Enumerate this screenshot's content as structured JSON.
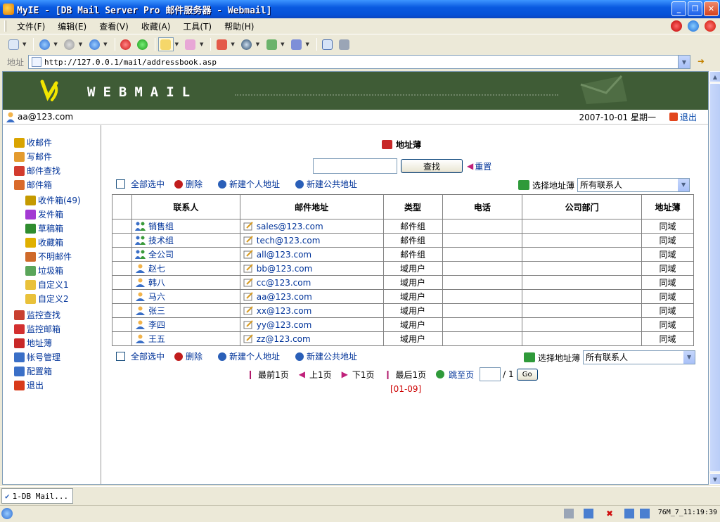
{
  "window": {
    "title": "MyIE - [DB Mail Server Pro 邮件服务器 - Webmail]"
  },
  "menu": [
    "文件(F)",
    "编辑(E)",
    "查看(V)",
    "收藏(A)",
    "工具(T)",
    "帮助(H)"
  ],
  "address": {
    "label": "地址",
    "url": "http://127.0.0.1/mail/addressbook.asp"
  },
  "banner": {
    "brand": "WEBMAIL"
  },
  "user": {
    "email": "aa@123.com",
    "date": "2007-10-01 星期一",
    "logout": "退出"
  },
  "sidebar": [
    {
      "label": "收邮件",
      "icon": "inbox-icon",
      "color": "#d9a400",
      "level": 0
    },
    {
      "label": "写邮件",
      "icon": "pencil-icon",
      "color": "#e49b2e",
      "level": 0
    },
    {
      "label": "邮件查找",
      "icon": "people-icon",
      "color": "#d23b2e",
      "level": 0
    },
    {
      "label": "邮件箱",
      "icon": "house-icon",
      "color": "#d96a2a",
      "level": 0
    },
    {
      "label": "收件箱(49)",
      "icon": "inbox-icon",
      "color": "#c59a00",
      "level": 1
    },
    {
      "label": "发件箱",
      "icon": "outbox-icon",
      "color": "#a33ad3",
      "level": 1
    },
    {
      "label": "草稿箱",
      "icon": "draft-icon",
      "color": "#2f8c2f",
      "level": 1
    },
    {
      "label": "收藏箱",
      "icon": "star-icon",
      "color": "#e0b000",
      "level": 1
    },
    {
      "label": "不明邮件",
      "icon": "unknown-mail-icon",
      "color": "#cf6a2a",
      "level": 1
    },
    {
      "label": "垃圾箱",
      "icon": "trash-icon",
      "color": "#5aa55a",
      "level": 1
    },
    {
      "label": "自定义1",
      "icon": "folder-icon",
      "color": "#e9c13a",
      "level": 1
    },
    {
      "label": "自定义2",
      "icon": "folder-icon",
      "color": "#e9c13a",
      "level": 1
    },
    {
      "label": "监控查找",
      "icon": "monitor-search-icon",
      "color": "#c84030",
      "level": 0
    },
    {
      "label": "监控邮箱",
      "icon": "monitor-mailbox-icon",
      "color": "#d33030",
      "level": 0
    },
    {
      "label": "地址薄",
      "icon": "addressbook-icon",
      "color": "#c82828",
      "level": 0
    },
    {
      "label": "帐号管理",
      "icon": "accounts-icon",
      "color": "#3a6fc7",
      "level": 0
    },
    {
      "label": "配置箱",
      "icon": "config-icon",
      "color": "#3a6fc7",
      "level": 0
    },
    {
      "label": "退出",
      "icon": "logout-icon",
      "color": "#d83a1a",
      "level": 0
    }
  ],
  "main": {
    "title": "地址薄",
    "search_button": "查找",
    "reset": "重置",
    "select_all": "全部选中",
    "delete": "删除",
    "new_personal": "新建个人地址",
    "new_public": "新建公共地址",
    "choose_book": "选择地址薄",
    "book_value": "所有联系人",
    "columns": [
      "联系人",
      "邮件地址",
      "类型",
      "电话",
      "公司部门",
      "地址薄"
    ],
    "rows": [
      {
        "name": "销售组",
        "email": "sales@123.com",
        "type": "邮件组",
        "phone": "",
        "dept": "",
        "book": "同域",
        "kind": "group"
      },
      {
        "name": "技术组",
        "email": "tech@123.com",
        "type": "邮件组",
        "phone": "",
        "dept": "",
        "book": "同域",
        "kind": "group"
      },
      {
        "name": "全公司",
        "email": "all@123.com",
        "type": "邮件组",
        "phone": "",
        "dept": "",
        "book": "同域",
        "kind": "group"
      },
      {
        "name": "赵七",
        "email": "bb@123.com",
        "type": "域用户",
        "phone": "",
        "dept": "",
        "book": "同域",
        "kind": "user"
      },
      {
        "name": "韩八",
        "email": "cc@123.com",
        "type": "域用户",
        "phone": "",
        "dept": "",
        "book": "同域",
        "kind": "user"
      },
      {
        "name": "马六",
        "email": "aa@123.com",
        "type": "域用户",
        "phone": "",
        "dept": "",
        "book": "同域",
        "kind": "user"
      },
      {
        "name": "张三",
        "email": "xx@123.com",
        "type": "域用户",
        "phone": "",
        "dept": "",
        "book": "同域",
        "kind": "user"
      },
      {
        "name": "李四",
        "email": "yy@123.com",
        "type": "域用户",
        "phone": "",
        "dept": "",
        "book": "同域",
        "kind": "user"
      },
      {
        "name": "王五",
        "email": "zz@123.com",
        "type": "域用户",
        "phone": "",
        "dept": "",
        "book": "同域",
        "kind": "user"
      }
    ],
    "pager": {
      "first": "最前1页",
      "prev": "上1页",
      "next": "下1页",
      "last": "最后1页",
      "jump": "跳至页",
      "total": "/ 1",
      "go": "Go",
      "range": "[01-09]"
    }
  },
  "tab": {
    "label": "1-DB Mail..."
  },
  "status": {
    "time": "76M_7_11:19:39"
  }
}
